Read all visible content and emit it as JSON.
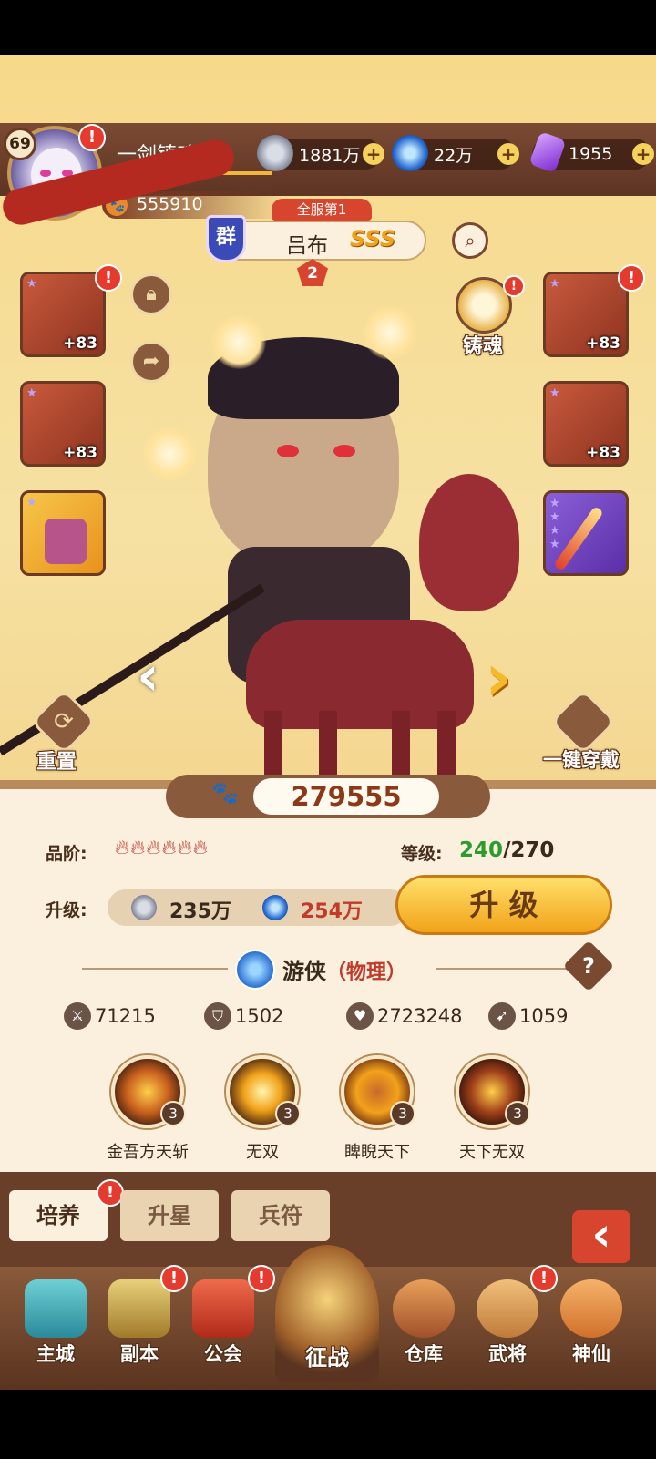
{
  "player": {
    "level": "69",
    "name": "一剑镇魂",
    "power": "555910"
  },
  "resources": [
    {
      "name": "coin-icon",
      "value": "1881万"
    },
    {
      "name": "orb-icon",
      "value": "22万"
    },
    {
      "name": "crystal-icon",
      "value": "1955"
    }
  ],
  "hero": {
    "rank_tag": "全服第1",
    "faction": "群",
    "name": "吕布",
    "grade": "SSS",
    "star": "2"
  },
  "equipment": [
    {
      "level": "+83"
    },
    {
      "level": "+83"
    },
    {
      "level": "+83"
    },
    {
      "level": "+83"
    }
  ],
  "actions": {
    "forge_soul": "铸魂",
    "reset": "重置",
    "equip_all": "一键穿戴"
  },
  "combat_power": "279555",
  "quality": {
    "label": "品阶:"
  },
  "level": {
    "label": "等级:",
    "current": "240",
    "max": "/270"
  },
  "upgrade": {
    "label": "升级:",
    "cost_coin": "235万",
    "cost_orb": "254万",
    "button": "升 级"
  },
  "class": {
    "name": "游侠",
    "type": "（物理）"
  },
  "stats": [
    {
      "icon": "attack-icon",
      "value": "71215"
    },
    {
      "icon": "defense-icon",
      "value": "1502"
    },
    {
      "icon": "hp-icon",
      "value": "2723248"
    },
    {
      "icon": "speed-icon",
      "value": "1059"
    }
  ],
  "skills": [
    {
      "name": "金吾方天斩",
      "level": "3"
    },
    {
      "name": "无双",
      "level": "3"
    },
    {
      "name": "睥睨天下",
      "level": "3"
    },
    {
      "name": "天下无双",
      "level": "3"
    }
  ],
  "tabs": [
    {
      "label": "培养"
    },
    {
      "label": "升星"
    },
    {
      "label": "兵符"
    }
  ],
  "nav": [
    {
      "label": "主城"
    },
    {
      "label": "副本"
    },
    {
      "label": "公会"
    },
    {
      "label": "征战"
    },
    {
      "label": "仓库"
    },
    {
      "label": "武将"
    },
    {
      "label": "神仙"
    }
  ],
  "colors": {
    "accent": "#f5b82a",
    "level_green": "#2e9b2e",
    "orb_red": "#c23a2a",
    "badge": "#e53a2d"
  }
}
